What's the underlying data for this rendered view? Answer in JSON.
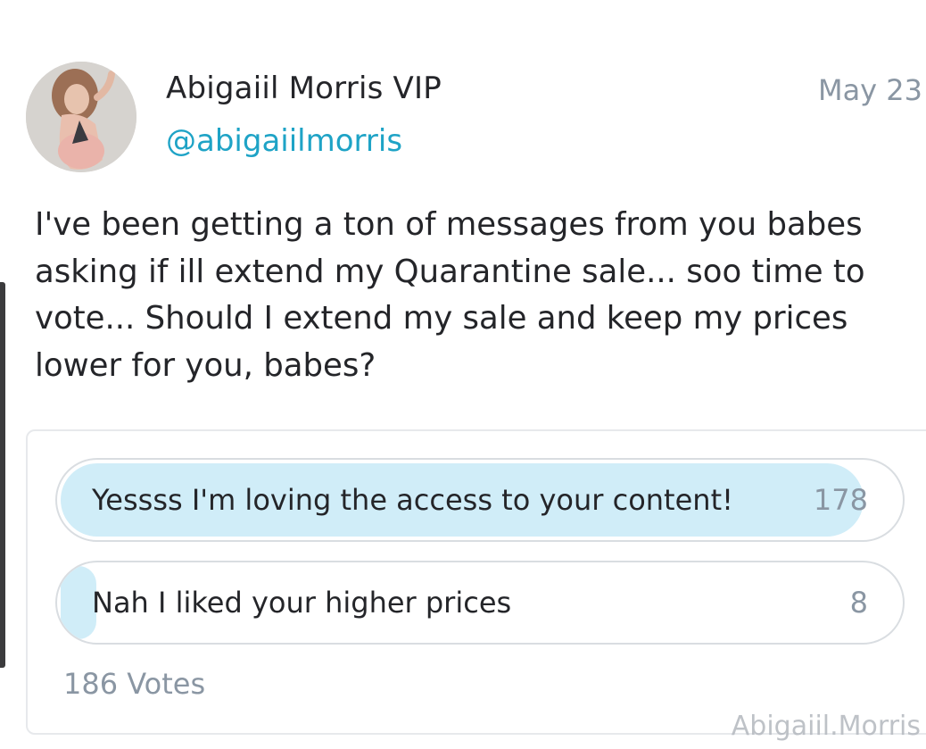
{
  "post": {
    "author": {
      "display_name": "Abigaiil Morris VIP",
      "username": "@abigaiilmorris",
      "avatar_icon": "avatar-photo"
    },
    "date": "May 23",
    "text": "I've been getting a ton of messages from you babes asking if ill extend my Quarantine sale... soo time to vote... Should I extend my sale and keep my prices lower for you, babes?"
  },
  "poll": {
    "options": [
      {
        "label": "Yessss I'm loving the access to your content!",
        "count": "178",
        "share": 0.957
      },
      {
        "label": "Nah I liked your higher prices",
        "count": "8",
        "share": 0.043
      }
    ],
    "total_votes": "186 Votes",
    "fill_color": "#d0edf8"
  },
  "watermark": "Abigaiil.Morris",
  "colors": {
    "accent": "#1ea3c6",
    "muted": "#8a96a3",
    "text": "#242529"
  }
}
